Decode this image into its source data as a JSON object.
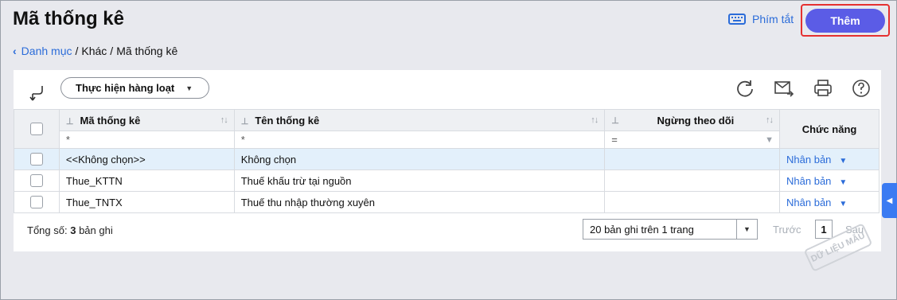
{
  "header": {
    "title": "Mã thống kê",
    "shortcut_label": "Phím tắt",
    "add_label": "Thêm"
  },
  "breadcrumb": {
    "root": "Danh mục",
    "sep1": "/",
    "middle": "Khác",
    "sep2": "/",
    "current": "Mã thống kê"
  },
  "toolbar": {
    "batch_label": "Thực hiện hàng loạt"
  },
  "table": {
    "columns": {
      "code": "Mã thống kê",
      "name": "Tên thống kê",
      "inactive": "Ngừng theo dõi",
      "actions": "Chức năng"
    },
    "filters": {
      "code_op": "*",
      "name_op": "*",
      "inactive_op": "="
    },
    "rows": [
      {
        "code": "<<Không chọn>>",
        "name": "Không chọn",
        "action": "Nhân bản"
      },
      {
        "code": "Thue_KTTN",
        "name": "Thuế khấu trừ tại nguồn",
        "action": "Nhân bản"
      },
      {
        "code": "Thue_TNTX",
        "name": "Thuế thu nhập thường xuyên",
        "action": "Nhân bản"
      }
    ]
  },
  "footer": {
    "total_prefix": "Tổng số:",
    "total_count": "3",
    "total_suffix": "bản ghi",
    "page_size": "20 bản ghi trên 1 trang",
    "prev_label": "Trước",
    "page_number": "1",
    "next_label": "Sau"
  },
  "watermark": "DỮ LIỆU MẪU",
  "colors": {
    "accent": "#2b6cd9",
    "add_button": "#5b5ce6",
    "highlight_border": "#e53030",
    "selected_row": "#e3f0fb"
  }
}
